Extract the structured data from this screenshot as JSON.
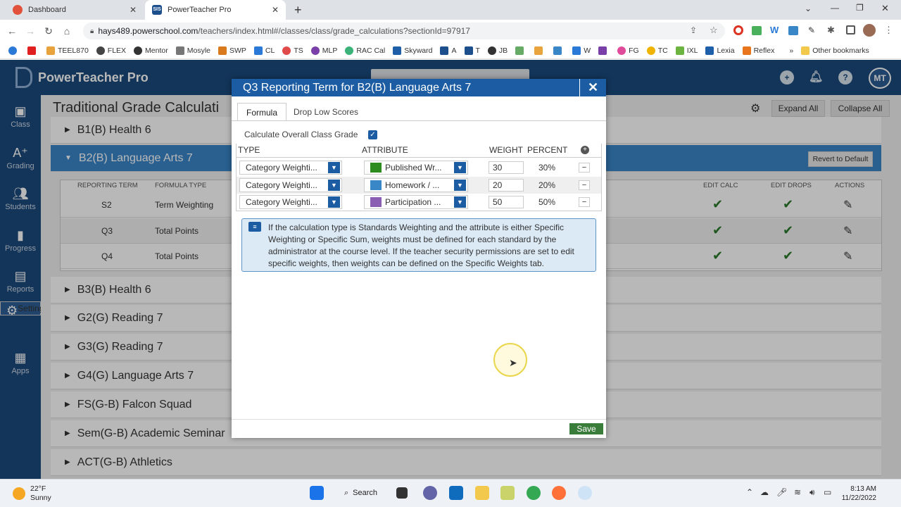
{
  "browser": {
    "tabs": [
      {
        "label": "Dashboard",
        "icon": "dashboard-favicon"
      },
      {
        "label": "PowerTeacher Pro",
        "icon": "sis-favicon"
      }
    ],
    "url_host": "hays489.powerschool.com",
    "url_path": "/teachers/index.html#/classes/class/grade_calculations?sectionId=97917",
    "bookmarks": [
      "TEEL870",
      "FLEX",
      "Mentor",
      "Mosyle",
      "SWP",
      "CL",
      "TS",
      "MLP",
      "RAC Cal",
      "Skyward",
      "A",
      "T",
      "JB",
      "W",
      "FG",
      "TC",
      "IXL",
      "Lexia",
      "Reflex"
    ],
    "other_bookmarks": "Other bookmarks"
  },
  "app": {
    "name": "PowerTeacher Pro",
    "avatar": "MT",
    "sidebar": [
      {
        "label": "Class",
        "icon": "class-icon"
      },
      {
        "label": "Grading",
        "icon": "grading-icon"
      },
      {
        "label": "Students",
        "icon": "students-icon"
      },
      {
        "label": "Progress",
        "icon": "progress-icon"
      },
      {
        "label": "Reports",
        "icon": "reports-icon"
      },
      {
        "label": "Settings",
        "icon": "settings-icon"
      },
      {
        "label": "Apps",
        "icon": "apps-icon"
      }
    ],
    "page_title": "Traditional Grade Calculati",
    "expand_all": "Expand All",
    "collapse_all": "Collapse All",
    "revert": "Revert to Default",
    "courses": [
      "B1(B) Health 6",
      "B2(B) Language Arts 7",
      "B3(B) Health 6",
      "G2(G) Reading 7",
      "G3(G) Reading 7",
      "G4(G) Language Arts 7",
      "FS(G-B) Falcon Squad",
      "Sem(G-B) Academic Seminar",
      "ACT(G-B) Athletics"
    ],
    "table_headers": {
      "term": "REPORTING TERM",
      "type": "FORMULA TYPE",
      "calc": "EDIT CALC",
      "drops": "EDIT DROPS",
      "actions": "ACTIONS"
    },
    "terms": [
      {
        "term": "S2",
        "type": "Term Weighting"
      },
      {
        "term": "Q3",
        "type": "Total Points"
      },
      {
        "term": "Q4",
        "type": "Total Points"
      }
    ]
  },
  "modal": {
    "title": "Q3 Reporting Term for B2(B) Language Arts 7",
    "tabs": [
      "Formula",
      "Drop Low Scores"
    ],
    "calc_label": "Calculate Overall Class Grade",
    "headers": {
      "type": "TYPE",
      "attribute": "ATTRIBUTE",
      "weight": "WEIGHT",
      "percent": "PERCENT"
    },
    "rows": [
      {
        "type": "Category Weighti...",
        "attribute": "Published Wr...",
        "color": "#2e8b1f",
        "weight": "30",
        "percent": "30%"
      },
      {
        "type": "Category Weighti...",
        "attribute": "Homework / ...",
        "color": "#3a87c7",
        "weight": "20",
        "percent": "20%"
      },
      {
        "type": "Category Weighti...",
        "attribute": "Participation ...",
        "color": "#8a5fb3",
        "weight": "50",
        "percent": "50%"
      }
    ],
    "info": "If the calculation type is Standards Weighting and the attribute is either Specific Weighting or Specific Sum, weights must be defined for each standard by the administrator at the course level. If the teacher security permissions are set to edit specific weights, then weights can be defined on the Specific Weights tab.",
    "save": "Save"
  },
  "taskbar": {
    "temp": "22°F",
    "weather": "Sunny",
    "search": "Search",
    "time": "8:13 AM",
    "date": "11/22/2022"
  }
}
